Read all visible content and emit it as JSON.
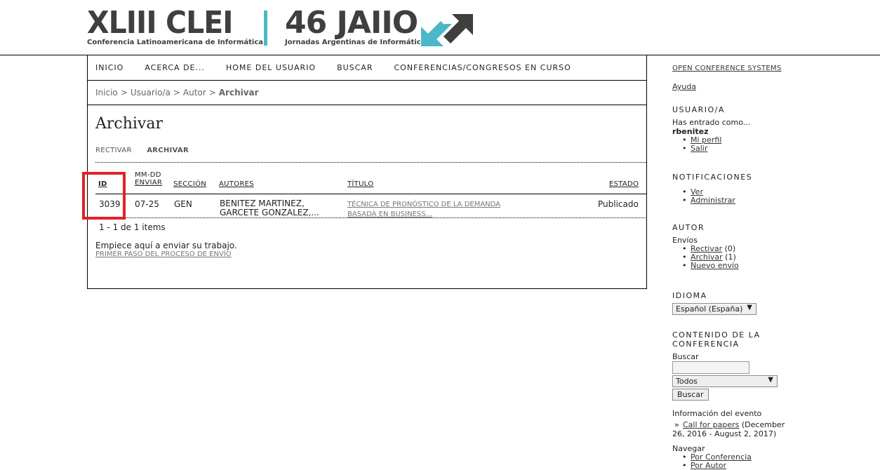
{
  "header": {
    "logo1_title": "XLIII CLEI",
    "logo1_subtitle": "Conferencia Latinoamericana de Informática",
    "logo2_title": "46 JAIIO",
    "logo2_subtitle": "Jornadas Argentinas de Informática",
    "accent_color": "#4bb8c9"
  },
  "navbar": {
    "items": [
      "INICIO",
      "ACERCA DE...",
      "HOME DEL USUARIO",
      "BUSCAR",
      "CONFERENCIAS/CONGRESOS EN CURSO"
    ]
  },
  "breadcrumb": {
    "items": [
      "Inicio",
      "Usuario/a",
      "Autor"
    ],
    "separator": ">",
    "current": "Archivar"
  },
  "page": {
    "title": "Archivar",
    "tabs": [
      "RECTIVAR",
      "ARCHIVAR"
    ]
  },
  "table": {
    "headers": {
      "id": "ID",
      "date_top": "MM-DD",
      "date_bottom": "ENVIAR",
      "section": "SECCIÓN",
      "authors": "AUTORES",
      "title": "TÍTULO",
      "status": "ESTADO"
    },
    "rows": [
      {
        "id": "3039",
        "date": "07-25",
        "section": "GEN",
        "authors_line1": "BENITEZ MARTINEZ,",
        "authors_line2": "GARCETE GONZALEZ,...",
        "title_line1": "TÉCNICA DE PRONÓSTICO DE LA DEMANDA",
        "title_line2": "BASADA EN BUSINESS...",
        "status": "Publicado"
      }
    ],
    "items_count": "1 - 1 de 1 items",
    "highlight_color": "#e0222a"
  },
  "start": {
    "text": "Empiece aquí a enviar su trabajo.",
    "link": "PRIMER PASO DEL PROCESO DE ENVÍO"
  },
  "sidebar": {
    "ocs": "OPEN CONFERENCE SYSTEMS",
    "help": "Ayuda",
    "user_heading": "USUARIO/A",
    "logged_as": "Has entrado como...",
    "username": "rbenitez",
    "my_profile": "Mi perfil",
    "logout": "Salir",
    "notifications_heading": "NOTIFICACIONES",
    "view": "Ver",
    "manage": "Administrar",
    "author_heading": "AUTOR",
    "submissions": "Envíos",
    "active_label": "Rectivar",
    "active_count": "(0)",
    "archive_label": "Archivar",
    "archive_count": "(1)",
    "new_submission": "Nuevo envío",
    "language_heading": "IDIOMA",
    "language_value": "Español (España)",
    "content_heading_1": "CONTENIDO DE LA",
    "content_heading_2": "CONFERENCIA",
    "search_label": "Buscar",
    "search_scope": "Todos",
    "search_button": "Buscar",
    "event_info": "Información del evento",
    "call_for_papers": "Call for papers",
    "cfp_dates_1": "(December",
    "cfp_dates_2": "26, 2016 - August 2, 2017)",
    "browse": "Navegar",
    "by_conference": "Por Conferencia",
    "by_author": "Por Autor"
  }
}
